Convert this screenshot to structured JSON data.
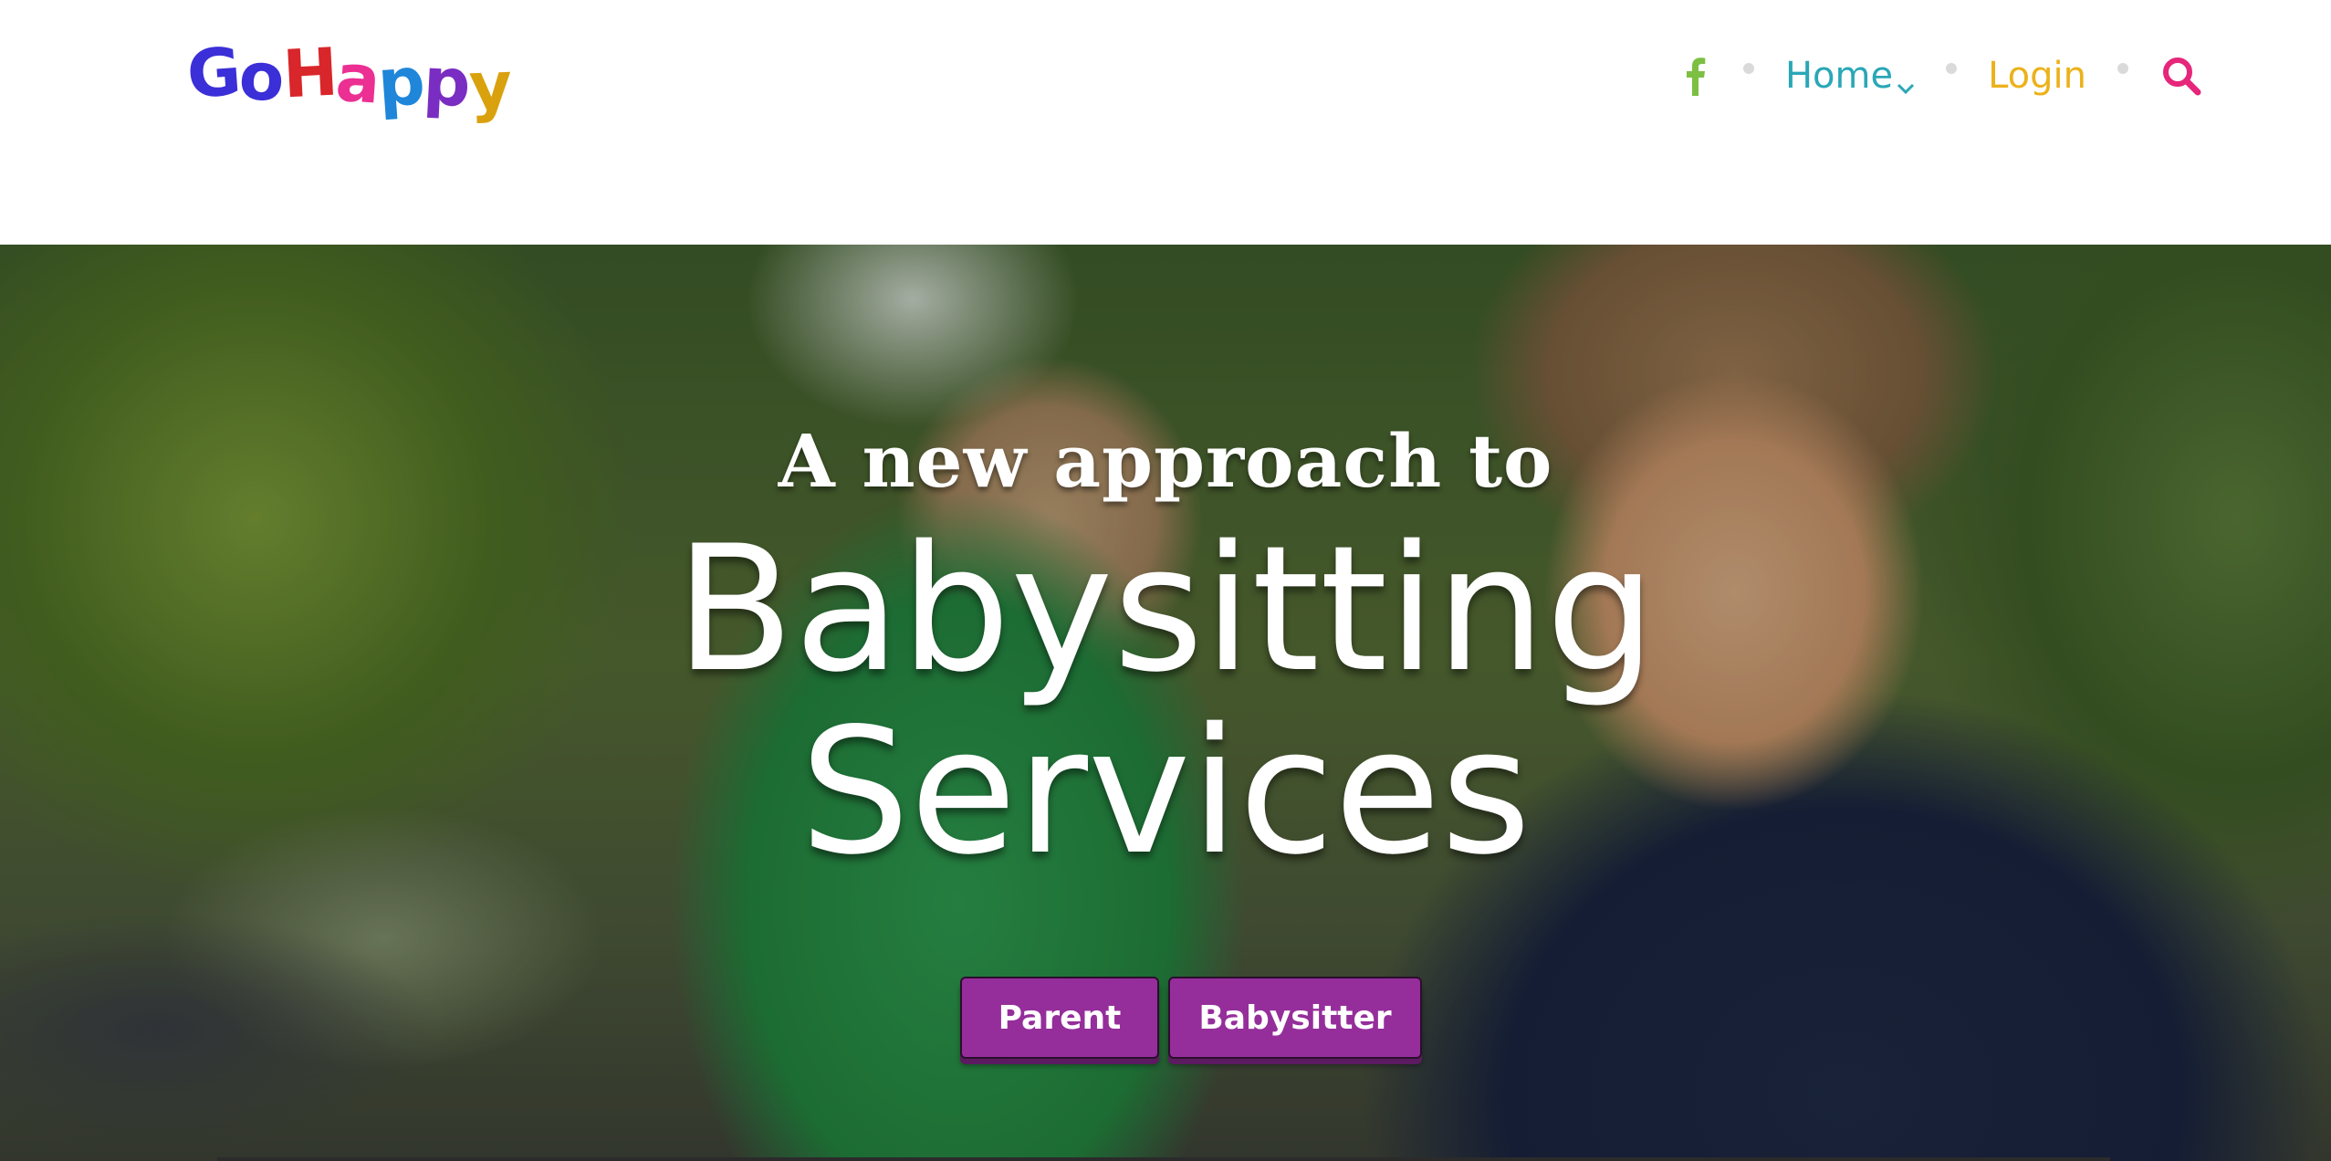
{
  "logo": {
    "text": "GoHappy",
    "letters": [
      {
        "char": "G",
        "color": "#3b2fd8"
      },
      {
        "char": "o",
        "color": "#3b2fd8"
      },
      {
        "char": "H",
        "color": "#d8262a"
      },
      {
        "char": "a",
        "color": "#ec2f93"
      },
      {
        "char": "p",
        "color": "#1f86d9"
      },
      {
        "char": "p",
        "color": "#7a2dc2"
      },
      {
        "char": "y",
        "color": "#d9a10e"
      }
    ]
  },
  "nav": {
    "facebook_icon": "facebook-icon",
    "home_label": "Home",
    "login_label": "Login",
    "search_icon": "search-icon",
    "colors": {
      "facebook": "#7cbf43",
      "home": "#2aa7b7",
      "login": "#ecb21c",
      "search": "#e6267a"
    }
  },
  "hero": {
    "tagline": "A new approach to",
    "headline_line1": "Babysitting",
    "headline_line2": "Services",
    "buttons": {
      "parent_label": "Parent",
      "babysitter_label": "Babysitter",
      "color": "#952e9b"
    }
  }
}
